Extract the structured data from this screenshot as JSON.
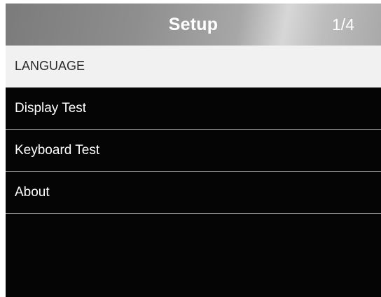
{
  "header": {
    "title": "Setup",
    "page_indicator": "1/4"
  },
  "menu": {
    "items": [
      {
        "label": "LANGUAGE",
        "selected": true
      },
      {
        "label": "Display Test",
        "selected": false
      },
      {
        "label": "Keyboard Test",
        "selected": false
      },
      {
        "label": "About",
        "selected": false
      }
    ]
  },
  "colors": {
    "screen_background": "#050505",
    "selected_row_background": "#f1f1f1",
    "header_gradient_dark": "#7b7b7b",
    "header_gradient_light": "#d7d7d7",
    "separator": "#b5b5b5"
  }
}
